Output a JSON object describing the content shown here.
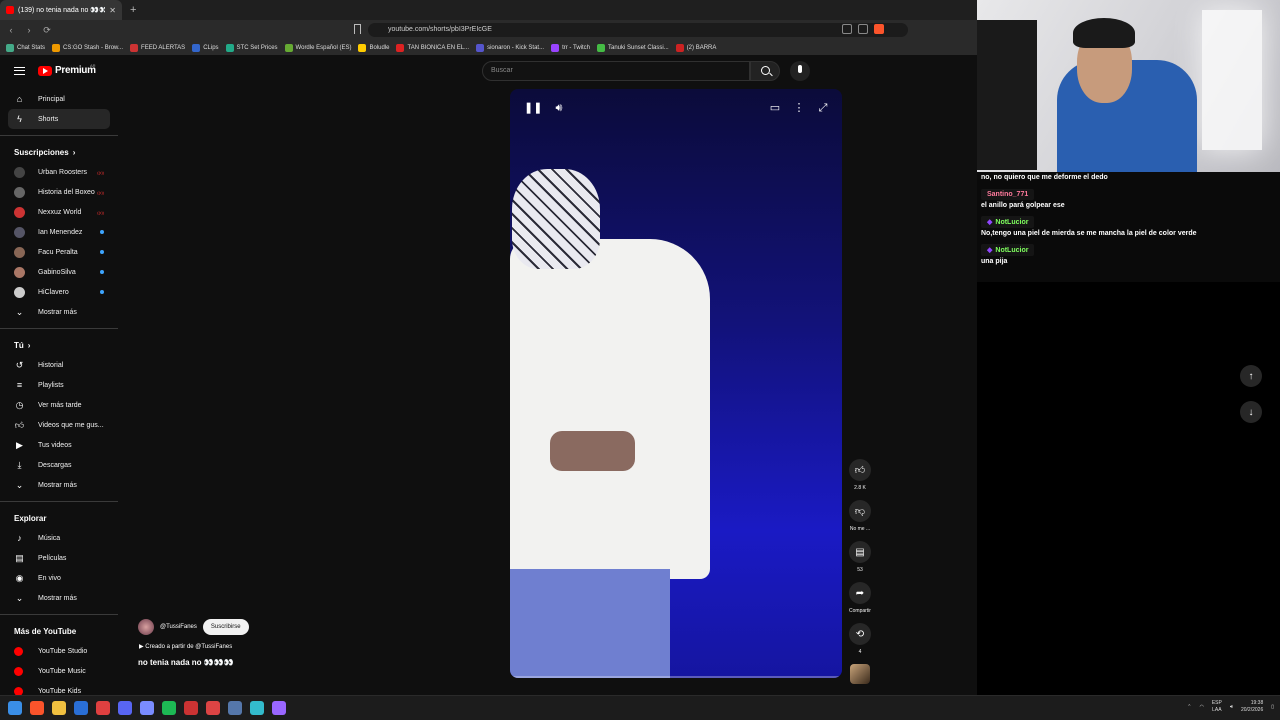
{
  "browser": {
    "tab_title": "(139) no tenia nada no 👀👀",
    "url": "youtube.com/shorts/pbI3PrEIcGE",
    "bookmarks": [
      "Chat Stats",
      "CS:GO Stash - Brow...",
      "FEED ALERTAS",
      "CLips",
      "STC Set Prices",
      "Wordle Español (ES)",
      "Boludle",
      "TAN BIONICA EN EL...",
      "sionaron - Kick Stat...",
      "trr - Twitch",
      "Tanuki Sunset Classi...",
      "(2) BARRA"
    ]
  },
  "youtube": {
    "logo": "Premium",
    "region": "AR",
    "search_placeholder": "Buscar",
    "nav": {
      "home": "Principal",
      "shorts": "Shorts"
    },
    "subscriptions_title": "Suscripciones",
    "subscriptions": [
      {
        "name": "Urban Roosters",
        "status": "live"
      },
      {
        "name": "Historia del Boxeo",
        "status": "live"
      },
      {
        "name": "Nexxuz World",
        "status": "live"
      },
      {
        "name": "Ian Menendez",
        "status": "new"
      },
      {
        "name": "Facu Peralta",
        "status": "new"
      },
      {
        "name": "GabinoSilva",
        "status": "new"
      },
      {
        "name": "HiClavero",
        "status": "new"
      }
    ],
    "show_more": "Mostrar más",
    "you_title": "Tú",
    "you_items": [
      "Historial",
      "Playlists",
      "Ver más tarde",
      "Videos que me gus...",
      "Tus videos",
      "Descargas",
      "Mostrar más"
    ],
    "explore_title": "Explorar",
    "explore_items": [
      "Música",
      "Películas",
      "En vivo",
      "Mostrar más"
    ],
    "more_title": "Más de YouTube",
    "more_items": [
      "YouTube Studio",
      "YouTube Music",
      "YouTube Kids"
    ],
    "short": {
      "channel": "@TussiFanes",
      "subscribe": "Suscribirse",
      "created_from": "Creado a partir de @TussiFanes",
      "title": "no tenia nada no 👀👀👀",
      "likes": "2.8 K",
      "dislike": "No me ...",
      "comments": "53",
      "share": "Compartir",
      "remix": "4"
    }
  },
  "chat": {
    "messages": [
      {
        "user": "",
        "text": "no, no quiero que me deforme el dedo"
      },
      {
        "user": "Santino_771",
        "text": "el anillo pará golpear ese",
        "color": "#ff7a9c"
      },
      {
        "user": "NotLucior",
        "text": "No,tengo una piel de mierda se me mancha la piel de color verde",
        "color": "#7fff5e"
      },
      {
        "user": "NotLucior",
        "text": "una pija",
        "color": "#7fff5e"
      }
    ]
  },
  "taskbar": {
    "lang": "ESP",
    "lang2": "LAA",
    "time": "19:38",
    "date": "20/2/2026"
  }
}
